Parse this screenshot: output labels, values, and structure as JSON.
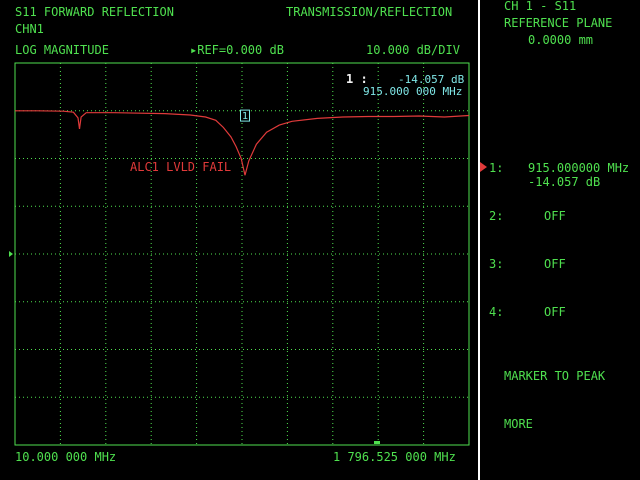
{
  "header": {
    "measurement": "S11 FORWARD REFLECTION",
    "mode": "TRANSMISSION/REFLECTION",
    "channel": "CHN1",
    "format": "LOG MAGNITUDE",
    "reference_prefix": "▸REF=",
    "reference_value": "0.000 dB",
    "scale": "10.000 dB/DIV"
  },
  "marker_readout": {
    "label": "1 :",
    "value": "-14.057 dB",
    "frequency": "915.000 000 MHz"
  },
  "status": {
    "message": "ALC1 LVLD FAIL"
  },
  "trace_marker": {
    "label": "1",
    "frequency_mhz": 915.0,
    "value_db": -14.057
  },
  "frequency_axis": {
    "start_label": "10.000 000 MHz",
    "stop_label": "1 796.525 000 MHz",
    "start_mhz": 10.0,
    "stop_mhz": 1796.525
  },
  "side_panel": {
    "title": "CH 1 - S11",
    "subtitle": "REFERENCE PLANE",
    "reference_plane": "0.0000 mm",
    "markers": [
      {
        "index": "1:",
        "line1": "915.000000 MHz",
        "line2": "-14.057 dB",
        "active": true
      },
      {
        "index": "2:",
        "line1": "OFF",
        "line2": "",
        "active": false
      },
      {
        "index": "3:",
        "line1": "OFF",
        "line2": "",
        "active": false
      },
      {
        "index": "4:",
        "line1": "OFF",
        "line2": "",
        "active": false
      }
    ],
    "actions": [
      "MARKER TO PEAK",
      "MORE"
    ]
  },
  "colors": {
    "text": "#4fe04f",
    "grid": "#4fe04f",
    "trace": "#e03a3a",
    "readout": "#7fe6e6",
    "background": "#000000"
  },
  "chart_data": {
    "type": "line",
    "title": "S11 FORWARD REFLECTION",
    "xlabel": "",
    "ylabel": "",
    "x_unit": "MHz",
    "y_unit": "dB",
    "xlim": [
      10.0,
      1796.525
    ],
    "ylim": [
      -80,
      0
    ],
    "grid": true,
    "reference_db": 0.0,
    "scale_db_per_div": 10.0,
    "series": [
      {
        "x": [
          10,
          100,
          200,
          240,
          258,
          264,
          270,
          290,
          400,
          600,
          700,
          760,
          800,
          830,
          860,
          880,
          900,
          915,
          930,
          960,
          1000,
          1050,
          1100,
          1200,
          1300,
          1400,
          1500,
          1600,
          1700,
          1796.5
        ],
        "y": [
          -10.0,
          -10.0,
          -10.1,
          -10.3,
          -11.5,
          -13.8,
          -11.3,
          -10.4,
          -10.4,
          -10.6,
          -10.9,
          -11.3,
          -12.0,
          -13.5,
          -15.5,
          -17.5,
          -20.0,
          -23.5,
          -20.5,
          -17.0,
          -14.5,
          -13.0,
          -12.2,
          -11.6,
          -11.3,
          -11.2,
          -11.2,
          -11.1,
          -11.3,
          -11.0
        ]
      }
    ]
  }
}
